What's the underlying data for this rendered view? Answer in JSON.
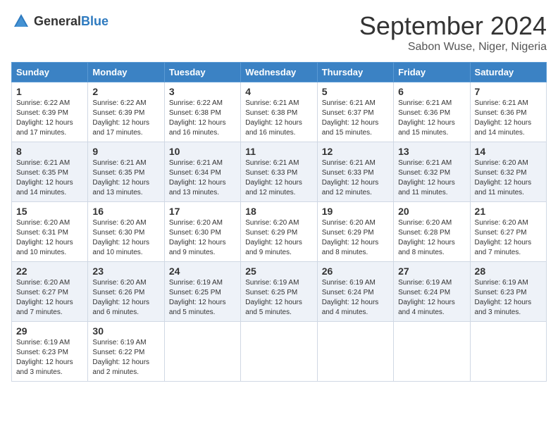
{
  "header": {
    "logo_general": "General",
    "logo_blue": "Blue",
    "month_year": "September 2024",
    "location": "Sabon Wuse, Niger, Nigeria"
  },
  "days_of_week": [
    "Sunday",
    "Monday",
    "Tuesday",
    "Wednesday",
    "Thursday",
    "Friday",
    "Saturday"
  ],
  "weeks": [
    [
      {
        "day": 1,
        "sunrise": "6:22 AM",
        "sunset": "6:39 PM",
        "daylight": "12 hours and 17 minutes."
      },
      {
        "day": 2,
        "sunrise": "6:22 AM",
        "sunset": "6:39 PM",
        "daylight": "12 hours and 17 minutes."
      },
      {
        "day": 3,
        "sunrise": "6:22 AM",
        "sunset": "6:38 PM",
        "daylight": "12 hours and 16 minutes."
      },
      {
        "day": 4,
        "sunrise": "6:21 AM",
        "sunset": "6:38 PM",
        "daylight": "12 hours and 16 minutes."
      },
      {
        "day": 5,
        "sunrise": "6:21 AM",
        "sunset": "6:37 PM",
        "daylight": "12 hours and 15 minutes."
      },
      {
        "day": 6,
        "sunrise": "6:21 AM",
        "sunset": "6:36 PM",
        "daylight": "12 hours and 15 minutes."
      },
      {
        "day": 7,
        "sunrise": "6:21 AM",
        "sunset": "6:36 PM",
        "daylight": "12 hours and 14 minutes."
      }
    ],
    [
      {
        "day": 8,
        "sunrise": "6:21 AM",
        "sunset": "6:35 PM",
        "daylight": "12 hours and 14 minutes."
      },
      {
        "day": 9,
        "sunrise": "6:21 AM",
        "sunset": "6:35 PM",
        "daylight": "12 hours and 13 minutes."
      },
      {
        "day": 10,
        "sunrise": "6:21 AM",
        "sunset": "6:34 PM",
        "daylight": "12 hours and 13 minutes."
      },
      {
        "day": 11,
        "sunrise": "6:21 AM",
        "sunset": "6:33 PM",
        "daylight": "12 hours and 12 minutes."
      },
      {
        "day": 12,
        "sunrise": "6:21 AM",
        "sunset": "6:33 PM",
        "daylight": "12 hours and 12 minutes."
      },
      {
        "day": 13,
        "sunrise": "6:21 AM",
        "sunset": "6:32 PM",
        "daylight": "12 hours and 11 minutes."
      },
      {
        "day": 14,
        "sunrise": "6:20 AM",
        "sunset": "6:32 PM",
        "daylight": "12 hours and 11 minutes."
      }
    ],
    [
      {
        "day": 15,
        "sunrise": "6:20 AM",
        "sunset": "6:31 PM",
        "daylight": "12 hours and 10 minutes."
      },
      {
        "day": 16,
        "sunrise": "6:20 AM",
        "sunset": "6:30 PM",
        "daylight": "12 hours and 10 minutes."
      },
      {
        "day": 17,
        "sunrise": "6:20 AM",
        "sunset": "6:30 PM",
        "daylight": "12 hours and 9 minutes."
      },
      {
        "day": 18,
        "sunrise": "6:20 AM",
        "sunset": "6:29 PM",
        "daylight": "12 hours and 9 minutes."
      },
      {
        "day": 19,
        "sunrise": "6:20 AM",
        "sunset": "6:29 PM",
        "daylight": "12 hours and 8 minutes."
      },
      {
        "day": 20,
        "sunrise": "6:20 AM",
        "sunset": "6:28 PM",
        "daylight": "12 hours and 8 minutes."
      },
      {
        "day": 21,
        "sunrise": "6:20 AM",
        "sunset": "6:27 PM",
        "daylight": "12 hours and 7 minutes."
      }
    ],
    [
      {
        "day": 22,
        "sunrise": "6:20 AM",
        "sunset": "6:27 PM",
        "daylight": "12 hours and 7 minutes."
      },
      {
        "day": 23,
        "sunrise": "6:20 AM",
        "sunset": "6:26 PM",
        "daylight": "12 hours and 6 minutes."
      },
      {
        "day": 24,
        "sunrise": "6:19 AM",
        "sunset": "6:25 PM",
        "daylight": "12 hours and 5 minutes."
      },
      {
        "day": 25,
        "sunrise": "6:19 AM",
        "sunset": "6:25 PM",
        "daylight": "12 hours and 5 minutes."
      },
      {
        "day": 26,
        "sunrise": "6:19 AM",
        "sunset": "6:24 PM",
        "daylight": "12 hours and 4 minutes."
      },
      {
        "day": 27,
        "sunrise": "6:19 AM",
        "sunset": "6:24 PM",
        "daylight": "12 hours and 4 minutes."
      },
      {
        "day": 28,
        "sunrise": "6:19 AM",
        "sunset": "6:23 PM",
        "daylight": "12 hours and 3 minutes."
      }
    ],
    [
      {
        "day": 29,
        "sunrise": "6:19 AM",
        "sunset": "6:23 PM",
        "daylight": "12 hours and 3 minutes."
      },
      {
        "day": 30,
        "sunrise": "6:19 AM",
        "sunset": "6:22 PM",
        "daylight": "12 hours and 2 minutes."
      },
      null,
      null,
      null,
      null,
      null
    ]
  ]
}
